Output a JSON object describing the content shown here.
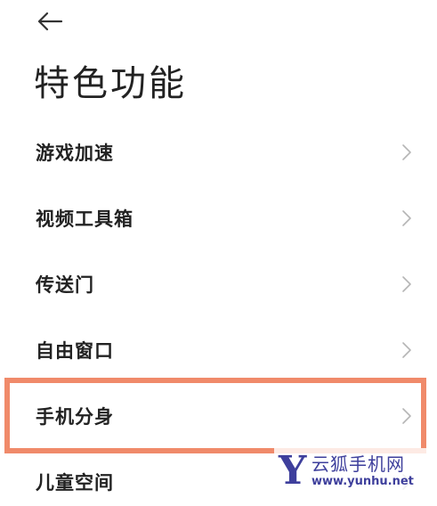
{
  "header": {
    "back_icon": "arrow-left-icon",
    "title": "特色功能"
  },
  "menu": {
    "chevron_icon": "chevron-right-icon",
    "items": [
      {
        "label": "游戏加速"
      },
      {
        "label": "视频工具箱"
      },
      {
        "label": "传送门"
      },
      {
        "label": "自由窗口"
      },
      {
        "label": "手机分身"
      },
      {
        "label": "儿童空间"
      }
    ]
  },
  "annotation": {
    "highlighted_item": "手机分身",
    "color": "#f08a6a"
  },
  "watermark": {
    "logo_letter": "Y",
    "name": "云狐手机网",
    "url": "www.yunhu.net",
    "color": "#3e3f9c"
  }
}
